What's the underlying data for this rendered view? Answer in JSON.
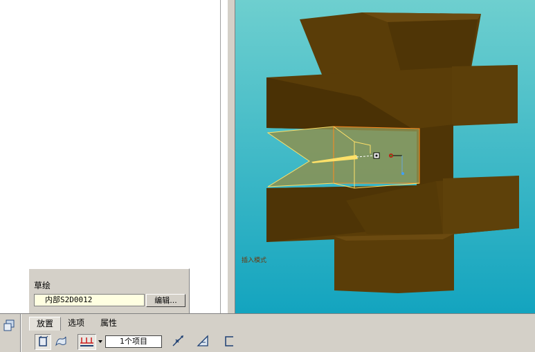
{
  "viewport": {
    "background_top": "#6ecfcf",
    "background_bottom": "#13a4bf",
    "model_color": "#5a3d08",
    "preview_color": "#8c9150",
    "preview_edge_color": "#ffe169",
    "label": "插入模式"
  },
  "sketch_panel": {
    "title": "草绘",
    "sketch_name": "内部S2D0012",
    "edit_button": "编辑..."
  },
  "dashboard": {
    "tabs": [
      {
        "label": "放置",
        "active": true
      },
      {
        "label": "选项",
        "active": false
      },
      {
        "label": "属性",
        "active": false
      }
    ],
    "collector_text": "1个项目",
    "icons": {
      "left": "feature-icon",
      "solid": "solid-icon",
      "surface": "surface-icon",
      "remove_material": "remove-material-icon",
      "dropdown": "chevron-down-icon",
      "flip": "flip-direction-icon",
      "thicken": "thicken-icon",
      "depth": "depth-icon"
    }
  }
}
